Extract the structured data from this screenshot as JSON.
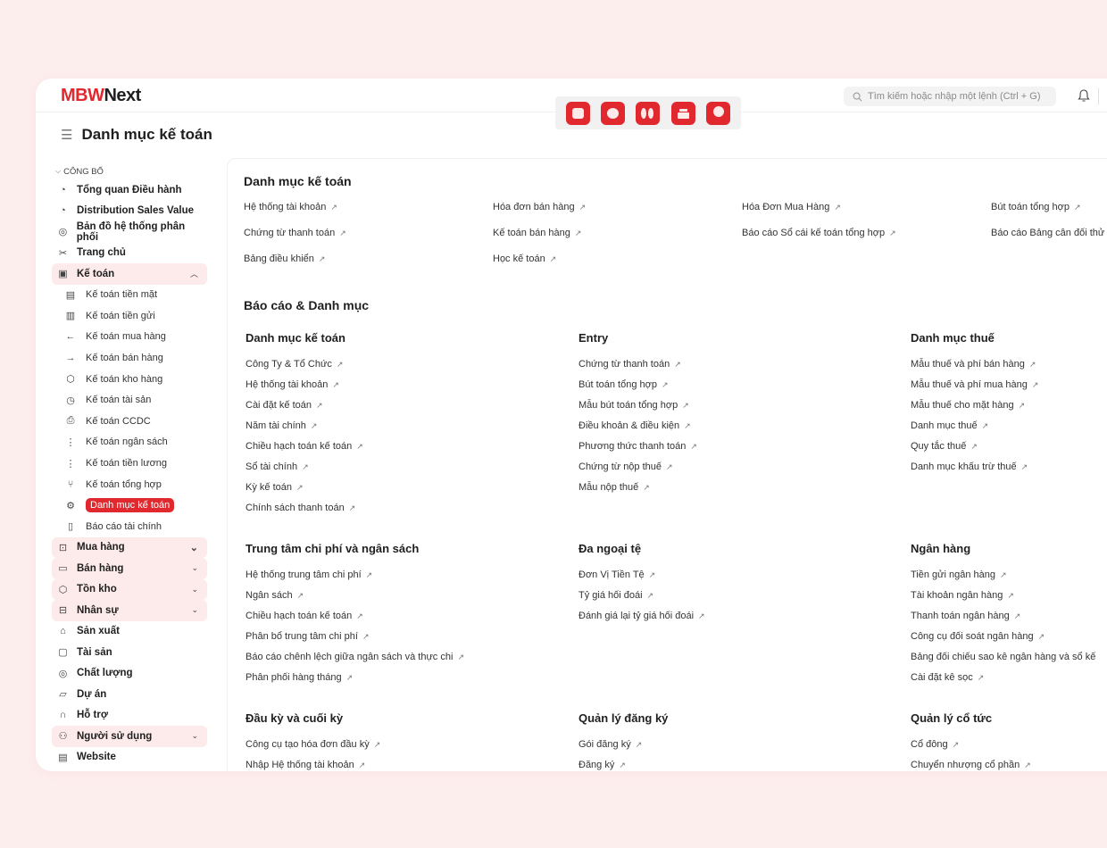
{
  "app": {
    "logo_mark": "MBW",
    "logo_text": "Next"
  },
  "search": {
    "placeholder": "Tìm kiếm hoặc nhập một lệnh (Ctrl + G)"
  },
  "page": {
    "title": "Danh mục kế toán"
  },
  "sidebar": {
    "section": "CÔNG BỐ",
    "top_items": [
      {
        "label": "Tổng quan Điều hành",
        "icon": "chart-icon"
      },
      {
        "label": "Distribution Sales Value",
        "icon": "chart-icon"
      },
      {
        "label": "Bản đồ hệ thống phân phối",
        "icon": "location-icon"
      },
      {
        "label": "Trang chủ",
        "icon": "tools-icon"
      },
      {
        "label": "Kế toán",
        "icon": "accounting-icon"
      }
    ],
    "sub_items": [
      {
        "label": "Kế toán tiền mặt"
      },
      {
        "label": "Kế toán tiền gửi"
      },
      {
        "label": "Kế toán mua hàng"
      },
      {
        "label": "Kế toán bán hàng"
      },
      {
        "label": "Kế toán kho hàng"
      },
      {
        "label": "Kế toán tài sản"
      },
      {
        "label": "Kế toán CCDC"
      },
      {
        "label": "Kế toán ngân sách"
      },
      {
        "label": "Kế toán tiền lương"
      },
      {
        "label": "Kế toán tổng hợp"
      },
      {
        "label": "Danh mục kế toán"
      },
      {
        "label": "Báo cáo tài chính"
      }
    ],
    "bottom_items": [
      {
        "label": "Mua hàng"
      },
      {
        "label": "Bán hàng"
      },
      {
        "label": "Tồn kho"
      },
      {
        "label": "Nhân sự"
      },
      {
        "label": "Sản xuất"
      },
      {
        "label": "Tài sản"
      },
      {
        "label": "Chất lượng"
      },
      {
        "label": "Dự án"
      },
      {
        "label": "Hỗ trợ"
      },
      {
        "label": "Người sử dụng"
      },
      {
        "label": "Website"
      }
    ]
  },
  "main": {
    "top_heading": "Danh mục kế toán",
    "quick_links": [
      "Hệ thống tài khoản",
      "Hóa đơn bán hàng",
      "Hóa Đơn Mua Hàng",
      "Bút toán tổng hợp",
      "Chứng từ thanh toán",
      "Kế toán bán hàng",
      "Báo cáo Sổ cái kế toán tổng hợp",
      "Báo cáo Bảng cân đối thử",
      "Bảng điều khiển",
      "Học kế toán"
    ],
    "reports_heading": "Báo cáo & Danh mục",
    "groups": [
      {
        "title": "Danh mục kế toán",
        "links": [
          "Công Ty & Tổ Chức",
          "Hệ thống tài khoản",
          "Cài đặt kế toán",
          "Năm tài chính",
          "Chiều hạch toán kế toán",
          "Sổ tài chính",
          "Kỳ kế toán",
          "Chính sách thanh toán"
        ]
      },
      {
        "title": "Entry",
        "links": [
          "Chứng từ thanh toán",
          "Bút toán tổng hợp",
          "Mẫu bút toán tổng hợp",
          "Điều khoản & điều kiện",
          "Phương thức thanh toán",
          "Chứng từ nộp thuế",
          "Mẫu nộp thuế"
        ]
      },
      {
        "title": "Danh mục thuế",
        "links": [
          "Mẫu thuế và phí bán hàng",
          "Mẫu thuế và phí mua hàng",
          "Mẫu thuế cho mặt hàng",
          "Danh mục thuế",
          "Quy tắc thuế",
          "Danh mục khấu trừ thuế"
        ]
      },
      {
        "title": "Trung tâm chi phí và ngân sách",
        "links": [
          "Hệ thống trung tâm chi phí",
          "Ngân sách",
          "Chiều hạch toán kế toán",
          "Phân bổ trung tâm chi phí",
          "Báo cáo chênh lệch giữa ngân sách và thực chi",
          "Phân phối hàng tháng"
        ]
      },
      {
        "title": "Đa ngoại tệ",
        "links": [
          "Đơn Vị Tiền Tệ",
          "Tỷ giá hối đoái",
          "Đánh giá lại tỷ giá hối đoái"
        ]
      },
      {
        "title": "Ngân hàng",
        "links": [
          "Tiền gửi ngân hàng",
          "Tài khoản ngân hàng",
          "Thanh toán ngân hàng",
          "Công cụ đối soát ngân hàng",
          "Bảng đối chiếu sao kê ngân hàng và sổ kế",
          "Cài đặt kê sọc"
        ]
      },
      {
        "title": "Đầu kỳ và cuối kỳ",
        "links": [
          "Công cụ tạo hóa đơn đầu kỳ",
          "Nhập Hệ thống tài khoản"
        ]
      },
      {
        "title": "Quản lý đăng ký",
        "links": [
          "Gói đăng ký",
          "Đăng ký"
        ]
      },
      {
        "title": "Quản lý cổ tức",
        "links": [
          "Cổ đông",
          "Chuyển nhượng cổ phần"
        ]
      }
    ]
  },
  "colors": {
    "accent": "#e0282e",
    "bg": "#fdeeee",
    "highlight": "#fdeaea"
  }
}
